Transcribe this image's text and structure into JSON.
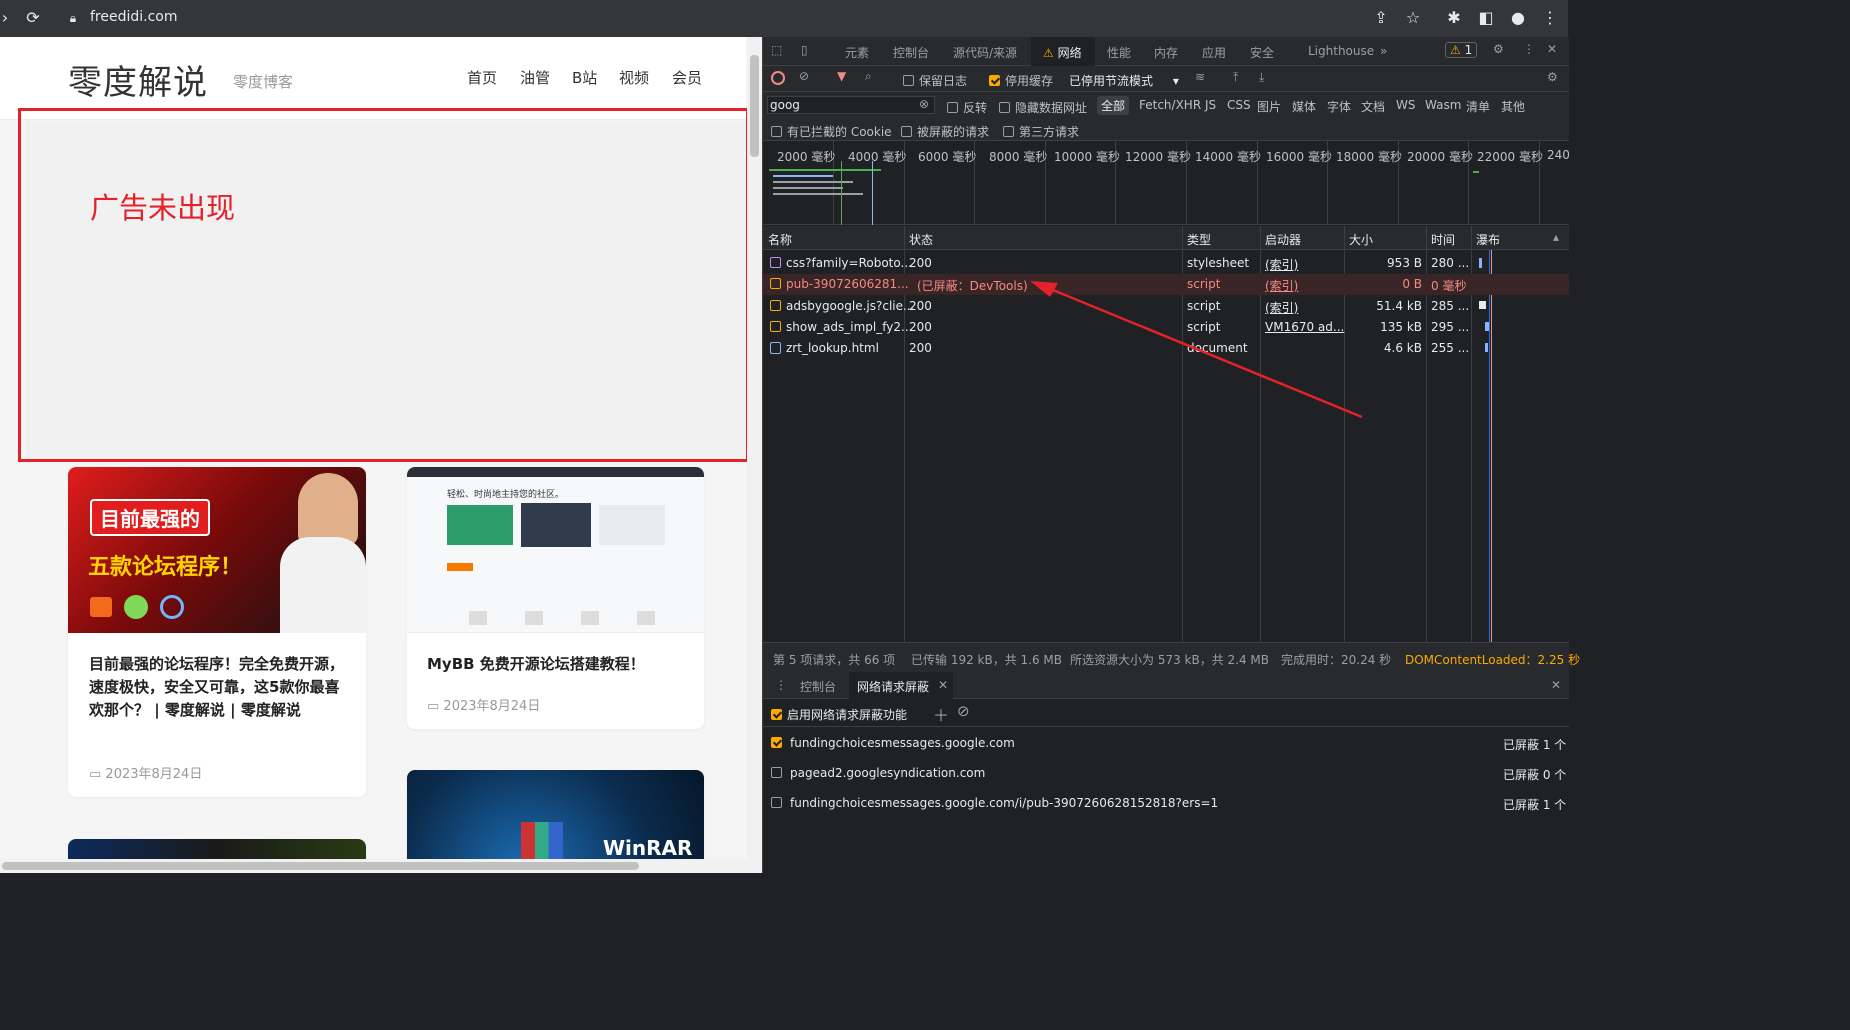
{
  "browser": {
    "url": "freedidi.com"
  },
  "site": {
    "logo": "零度解说",
    "subtitle": "零度博客",
    "nav": [
      "首页",
      "油管",
      "B站",
      "视频",
      "会员"
    ],
    "ad_missing_text": "广告未出现",
    "cards": [
      {
        "title": "目前最强的论坛程序！完全免费开源，速度极快，安全又可靠，这5款你最喜欢那个？ | 零度解说 | 零度解说",
        "date": "2023年8月24日",
        "thumb_line1": "目前最强的",
        "thumb_line2": "五款论坛程序！"
      },
      {
        "title": "MyBB 免费开源论坛搭建教程！",
        "date": "2023年8月24日",
        "thumb_caption": "轻松、时尚地主持您的社区。"
      },
      {
        "thumb_caption": "WinRAR"
      }
    ]
  },
  "devtools": {
    "tabs": [
      "元素",
      "控制台",
      "源代码/来源",
      "网络",
      "性能",
      "内存",
      "应用",
      "安全",
      "Lighthouse"
    ],
    "active_tab": "网络",
    "warning_count": "1",
    "toolbar": {
      "preserve_log": "保留日志",
      "disable_cache": "停用缓存",
      "throttle": "已停用节流模式"
    },
    "filter": {
      "value": "goog",
      "invert": "反转",
      "hide_data_urls": "隐藏数据网址",
      "types": [
        "全部",
        "Fetch/XHR",
        "JS",
        "CSS",
        "图片",
        "媒体",
        "字体",
        "文档",
        "WS",
        "Wasm",
        "清单",
        "其他"
      ],
      "blocked_cookies": "有已拦截的 Cookie",
      "blocked_requests": "被屏蔽的请求",
      "third_party": "第三方请求"
    },
    "timeline_labels": [
      "2000 毫秒",
      "4000 毫秒",
      "6000 毫秒",
      "8000 毫秒",
      "10000 毫秒",
      "12000 毫秒",
      "14000 毫秒",
      "16000 毫秒",
      "18000 毫秒",
      "20000 毫秒",
      "22000 毫秒",
      "240"
    ],
    "columns": [
      "名称",
      "状态",
      "类型",
      "启动器",
      "大小",
      "时间",
      "瀑布"
    ],
    "rows": [
      {
        "name": "css?family=Roboto...",
        "status": "200",
        "type": "stylesheet",
        "initiator": "(索引)",
        "size": "953 B",
        "time": "280 ...",
        "blocked": false
      },
      {
        "name": "pub-39072606281...",
        "status": "(已屏蔽：DevTools)",
        "type": "script",
        "initiator": "(索引)",
        "size": "0 B",
        "time": "0 毫秒",
        "blocked": true
      },
      {
        "name": "adsbygoogle.js?clie...",
        "status": "200",
        "type": "script",
        "initiator": "(索引)",
        "size": "51.4 kB",
        "time": "285 ...",
        "blocked": false
      },
      {
        "name": "show_ads_impl_fy2...",
        "status": "200",
        "type": "script",
        "initiator": "VM1670 ad...",
        "size": "135 kB",
        "time": "295 ...",
        "blocked": false
      },
      {
        "name": "zrt_lookup.html",
        "status": "200",
        "type": "document",
        "initiator": "",
        "size": "4.6 kB",
        "time": "255 ...",
        "blocked": false
      }
    ],
    "summary": {
      "requests": "第 5 项请求，共 66 项",
      "transferred": "已传输 192 kB，共 1.6 MB",
      "resources": "所选资源大小为 573 kB，共 2.4 MB",
      "finish": "完成用时：20.24 秒",
      "dcl": "DOMContentLoaded：2.25 秒"
    },
    "drawer": {
      "tabs": [
        "控制台",
        "网络请求屏蔽"
      ],
      "enable_label": "启用网络请求屏蔽功能",
      "patterns": [
        {
          "url": "fundingchoicesmessages.google.com",
          "checked": true,
          "count": "已屏蔽 1 个"
        },
        {
          "url": "pagead2.googlesyndication.com",
          "checked": false,
          "count": "已屏蔽 0 个"
        },
        {
          "url": "fundingchoicesmessages.google.com/i/pub-3907260628152818?ers=1",
          "checked": false,
          "count": "已屏蔽 1 个"
        }
      ]
    }
  },
  "colors": {
    "accent_red": "#e3222b",
    "devtools_bg": "#202124",
    "warning": "#f9ab00",
    "blocked_text": "#f28b82"
  }
}
